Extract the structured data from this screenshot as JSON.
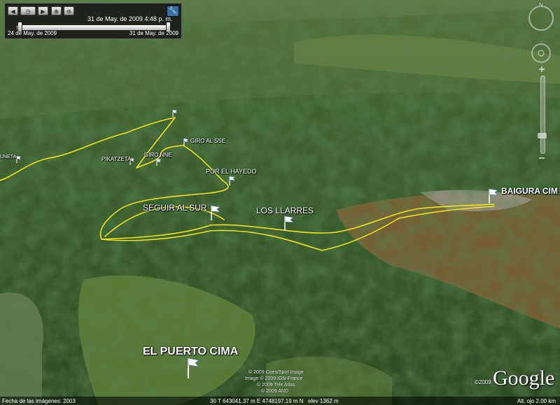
{
  "time_slider": {
    "current": "31 de May. de 2009 4:48 p. m.",
    "start": "24 de May. de 2009",
    "end": "31 de May. de 2009"
  },
  "placemarks": {
    "baigura_cima": "BAIGURA CIM",
    "los_llarres": "LOS LLARRES",
    "seguir_al_sur": "SEGUIR AL SUR",
    "por_el_hayedo": "POR EL HAYEDO",
    "giro_al_sse": "GIRO AL SSE",
    "giro_nne": "GIRO NNE",
    "pikatzeta": "PIKATZETA",
    "uneta": "UNETA",
    "el_puerto_cima": "EL PUERTO CIMA"
  },
  "compass": {
    "north": "N"
  },
  "copyright": [
    "© 2009 Cnes/Spot Image",
    "Image © 2009 IGN-France",
    "© 2009 Tele Atlas",
    "© 2009 AND"
  ],
  "brand": {
    "logo": "Google",
    "year": "©2009"
  },
  "status": {
    "imagery_date": "Fecha de las imágenes: 2003",
    "coordinates": "30 T 643041.37 m E 4748197.19 m N",
    "elevation": "elev 1362 m",
    "eye_alt": "Alt. ojo 2.00 km"
  },
  "colors": {
    "track": "#f2e21a",
    "forest": "#2e5a26",
    "meadow": "#6d8a3a",
    "bare_soil": "#9a6a3a"
  }
}
